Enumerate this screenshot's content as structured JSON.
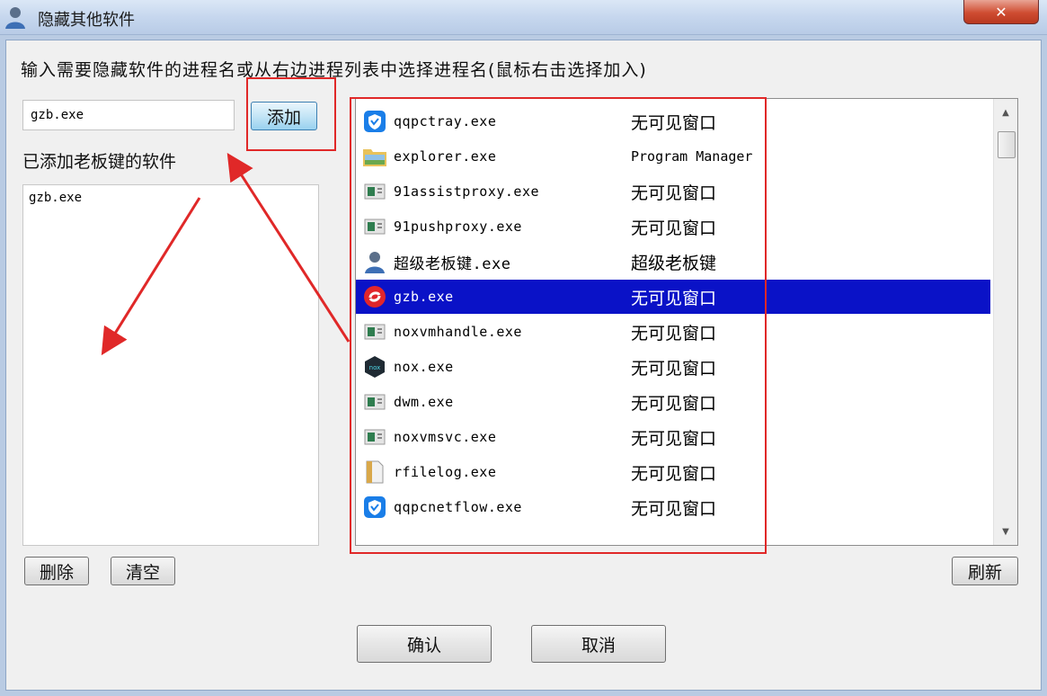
{
  "window": {
    "title": "隐藏其他软件",
    "close_icon": "close-icon"
  },
  "instruction": "输入需要隐藏软件的进程名或从右边进程列表中选择进程名(鼠标右击选择加入)",
  "input": {
    "value": "gzb.exe"
  },
  "buttons": {
    "add": "添加",
    "delete": "删除",
    "clear": "清空",
    "refresh": "刷新",
    "ok": "确认",
    "cancel": "取消"
  },
  "added": {
    "label": "已添加老板键的软件",
    "items": [
      "gzb.exe"
    ]
  },
  "processes": [
    {
      "name": "qqpctray.exe",
      "window": "无可见窗口",
      "icon": "shield-icon"
    },
    {
      "name": "explorer.exe",
      "window": "Program Manager",
      "icon": "folder-icon"
    },
    {
      "name": "91assistproxy.exe",
      "window": "无可见窗口",
      "icon": "app-icon"
    },
    {
      "name": "91pushproxy.exe",
      "window": "无可见窗口",
      "icon": "app-icon"
    },
    {
      "name": "超级老板键.exe",
      "window": "超级老板键",
      "icon": "user-icon"
    },
    {
      "name": "gzb.exe",
      "window": "无可见窗口",
      "icon": "gzb-icon",
      "selected": true
    },
    {
      "name": "noxvmhandle.exe",
      "window": "无可见窗口",
      "icon": "app-icon"
    },
    {
      "name": "nox.exe",
      "window": "无可见窗口",
      "icon": "nox-icon"
    },
    {
      "name": "dwm.exe",
      "window": "无可见窗口",
      "icon": "app-icon"
    },
    {
      "name": "noxvmsvc.exe",
      "window": "无可见窗口",
      "icon": "app-icon"
    },
    {
      "name": "rfilelog.exe",
      "window": "无可见窗口",
      "icon": "file-icon"
    },
    {
      "name": "qqpcnetflow.exe",
      "window": "无可见窗口",
      "icon": "shield-icon"
    }
  ],
  "colors": {
    "selection": "#0a12c7",
    "annotation": "#e02828"
  }
}
